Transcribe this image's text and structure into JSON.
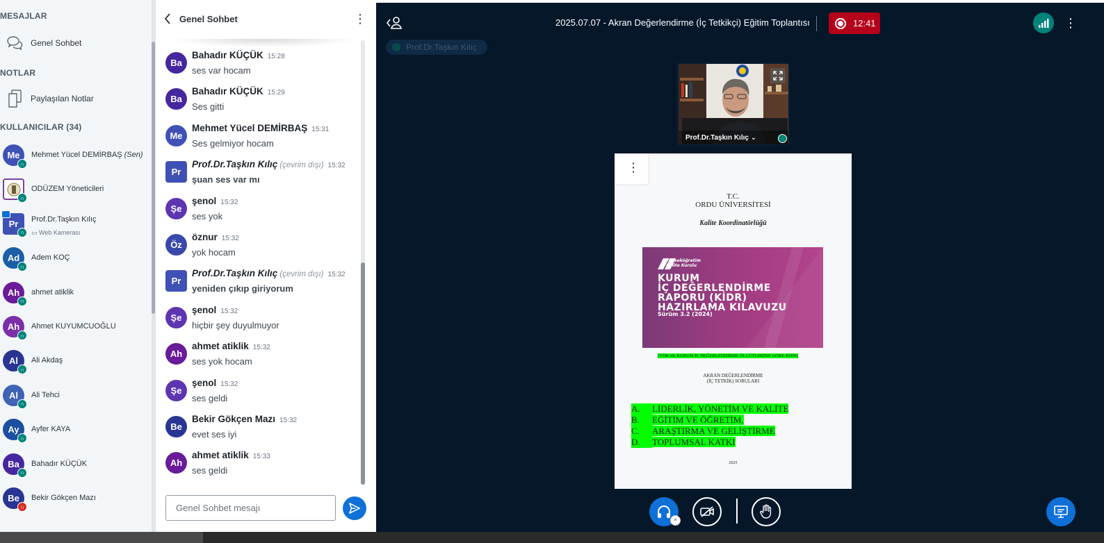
{
  "sidebar": {
    "messages_title": "MESAJLAR",
    "public_chat_label": "Genel Sohbet",
    "notes_title": "NOTLAR",
    "shared_notes_label": "Paylaşılan Notlar",
    "users_title": "KULLANICILAR (34)",
    "users": [
      {
        "initials": "Me",
        "name": "Mehmet Yücel DEMİRBAŞ",
        "suffix": "(Sen)",
        "color": "#3f51b5"
      },
      {
        "initials": "",
        "name": "ODÜZEM Yöneticileri",
        "color": "#7b3fa0"
      },
      {
        "initials": "Pr",
        "name": "Prof.Dr.Taşkın Kılıç",
        "sub": "Web Kamerası",
        "color": "#3f51b5"
      },
      {
        "initials": "Ad",
        "name": "Adem KOÇ",
        "color": "#1b5fa8"
      },
      {
        "initials": "Ah",
        "name": "ahmet atiklik",
        "color": "#6a1b9a"
      },
      {
        "initials": "Ah",
        "name": "Ahmet KUYUMCUOĞLU",
        "color": "#7b2fa8"
      },
      {
        "initials": "Al",
        "name": "Ali Akdaş",
        "color": "#283593"
      },
      {
        "initials": "Al",
        "name": "Ali Tehci",
        "color": "#3f63b5"
      },
      {
        "initials": "Ay",
        "name": "Ayfer KAYA",
        "color": "#1b4fa0"
      },
      {
        "initials": "Ba",
        "name": "Bahadır KÜÇÜK",
        "color": "#4527a0"
      },
      {
        "initials": "Be",
        "name": "Bekir Gökçen Mazı",
        "color": "#283593"
      }
    ]
  },
  "chat": {
    "title": "Genel Sohbet",
    "input_placeholder": "Genel Sohbet mesajı",
    "messages": [
      {
        "initials": "Ba",
        "name": "Bahadır KÜÇÜK",
        "time": "15:28",
        "text": "ses var hocam",
        "color": "#4527a0"
      },
      {
        "initials": "Ba",
        "name": "Bahadır KÜÇÜK",
        "time": "15:29",
        "text": "Ses gitti",
        "color": "#4527a0"
      },
      {
        "initials": "Me",
        "name": "Mehmet Yücel DEMİRBAŞ",
        "time": "15:31",
        "text": "Ses gelmiyor hocam",
        "color": "#3f51b5"
      },
      {
        "initials": "Pr",
        "name": "Prof.Dr.Taşkın Kılıç",
        "status": "(çevrim dışı)",
        "time": "15:32",
        "text": "şuan ses var mı",
        "color": "#3f51b5",
        "bold": true
      },
      {
        "initials": "Şe",
        "name": "şenol",
        "time": "15:32",
        "text": "ses yok",
        "color": "#5e35b1"
      },
      {
        "initials": "Öz",
        "name": "öznur",
        "time": "15:32",
        "text": "yok hocam",
        "color": "#3949ab"
      },
      {
        "initials": "Pr",
        "name": "Prof.Dr.Taşkın Kılıç",
        "status": "(çevrim dışı)",
        "time": "15:32",
        "text": "yeniden çıkıp giriyorum",
        "color": "#3f51b5",
        "bold": true
      },
      {
        "initials": "Şe",
        "name": "şenol",
        "time": "15:32",
        "text": "hiçbir şey duyulmuyor",
        "color": "#5e35b1"
      },
      {
        "initials": "Ah",
        "name": "ahmet atiklik",
        "time": "15:32",
        "text": "ses yok hocam",
        "color": "#6a1b9a"
      },
      {
        "initials": "Şe",
        "name": "şenol",
        "time": "15:32",
        "text": "ses geldi",
        "color": "#5e35b1"
      },
      {
        "initials": "Be",
        "name": "Bekir Gökçen Mazı",
        "time": "15:32",
        "text": "evet ses iyi",
        "color": "#283593"
      },
      {
        "initials": "Ah",
        "name": "ahmet atiklik",
        "time": "15:33",
        "text": "ses geldi",
        "color": "#6a1b9a"
      }
    ]
  },
  "meeting": {
    "title": "2025.07.07 - Akran Değerlendirme (İç Tetkikçi) Eğitim Toplantısı",
    "recording_time": "12:41",
    "talking_indicator": "Prof.Dr.Taşkın Kılıç",
    "webcam_name": "Prof.Dr.Taşkın Kılıç",
    "accent_color": "#0f70d7",
    "recording_color": "#b5001a"
  },
  "slide": {
    "line1": "T.C.",
    "line2": "ORDU ÜNİVERSİTESİ",
    "line3": "Kalite Koordinatörlüğü",
    "cover_brand": "Yükseköğretim\nKalite Kurulu",
    "cover_title": "KURUM\nİÇ DEĞERLENDİRME\nRAPORU (KİDR)\nHAZIRLAMA KILAVUZU",
    "cover_version": "Sürüm 3.2 (2024)",
    "yokak": "(YÖKAK KURUM İÇ DEĞERLENDİRME ÖLÇÜTLERİNE GÖRE-KİDR)",
    "sub1": "AKRAN DEĞERLENDİRME",
    "sub2": "(İÇ TETKİK) SORULARI",
    "items": [
      {
        "key": "A.",
        "text": "LİDERLİK, YÖNETİM VE KALİTE"
      },
      {
        "key": "B.",
        "text": "EĞİTİM VE ÖĞRETİM,"
      },
      {
        "key": "C.",
        "text": "ARAŞTIRMA VE GELİŞTİRME"
      },
      {
        "key": "D.",
        "text": "TOPLUMSAL KATKI"
      }
    ],
    "year": "2025"
  }
}
